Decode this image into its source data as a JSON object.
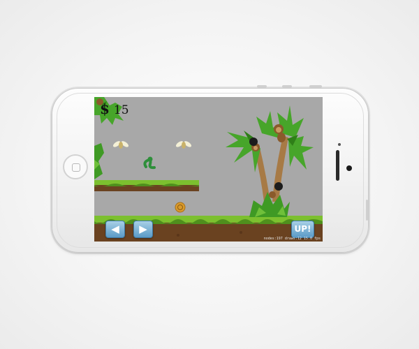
{
  "device": {
    "model": "iPhone (white, landscape)",
    "frame_color": "#f4f4f4",
    "screen_background": "#a8a8a8"
  },
  "hud": {
    "currency_symbol": "$",
    "money": "15"
  },
  "controls": {
    "left_icon": "◀",
    "right_icon": "▶",
    "jump_label": "UP!"
  },
  "debug": {
    "stats": "nodes:197 draws:12  15.0 fps"
  },
  "colors": {
    "grass": "#7cc02f",
    "grass_dark": "#4f8f1d",
    "dirt": "#6a4220",
    "palm_leaf": "#47a52a",
    "trunk": "#a77a45",
    "button_blue": "#5b9bc7",
    "coin": "#d99a2b"
  }
}
